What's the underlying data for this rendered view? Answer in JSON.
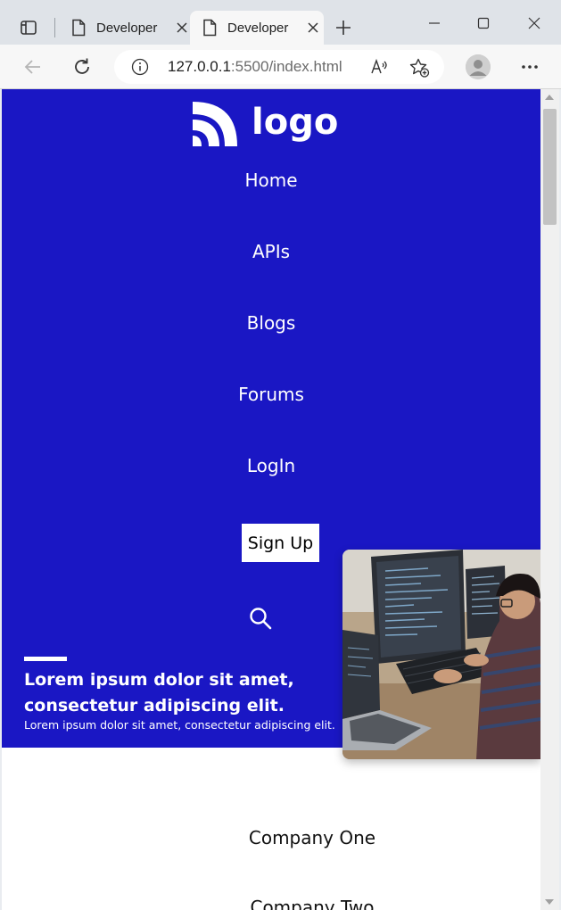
{
  "browser": {
    "tabs": [
      {
        "label": "Developer",
        "active": false
      },
      {
        "label": "Developer",
        "active": true
      }
    ],
    "address": {
      "host": "127.0.0.1",
      "path": ":5500/index.html"
    },
    "icons": {
      "tab_actions": "tab-actions-icon",
      "page": "page-icon",
      "close": "close-icon",
      "new_tab": "plus-icon",
      "minimize": "minimize-icon",
      "maximize": "maximize-icon",
      "window_close": "close-icon",
      "back": "back-arrow-icon",
      "refresh": "refresh-icon",
      "info": "info-icon",
      "read_aloud": "read-aloud-icon",
      "favorites": "add-favorite-icon",
      "profile": "profile-avatar-icon",
      "more": "more-icon"
    }
  },
  "page": {
    "logo_text": "logo",
    "nav": [
      {
        "label": "Home"
      },
      {
        "label": "APIs"
      },
      {
        "label": "Blogs"
      },
      {
        "label": "Forums"
      },
      {
        "label": "LogIn"
      }
    ],
    "signup_label": "Sign Up",
    "hero": {
      "heading": "Lorem ipsum dolor sit amet, consectetur adipiscing elit.",
      "subtext": "Lorem ipsum dolor sit amet, consectetur adipiscing elit."
    },
    "companies": [
      {
        "name": "Company One"
      },
      {
        "name": "Company Two"
      }
    ],
    "colors": {
      "hero_bg": "#1a17c4",
      "text_light": "#ffffff",
      "signup_bg": "#ffffff"
    }
  }
}
